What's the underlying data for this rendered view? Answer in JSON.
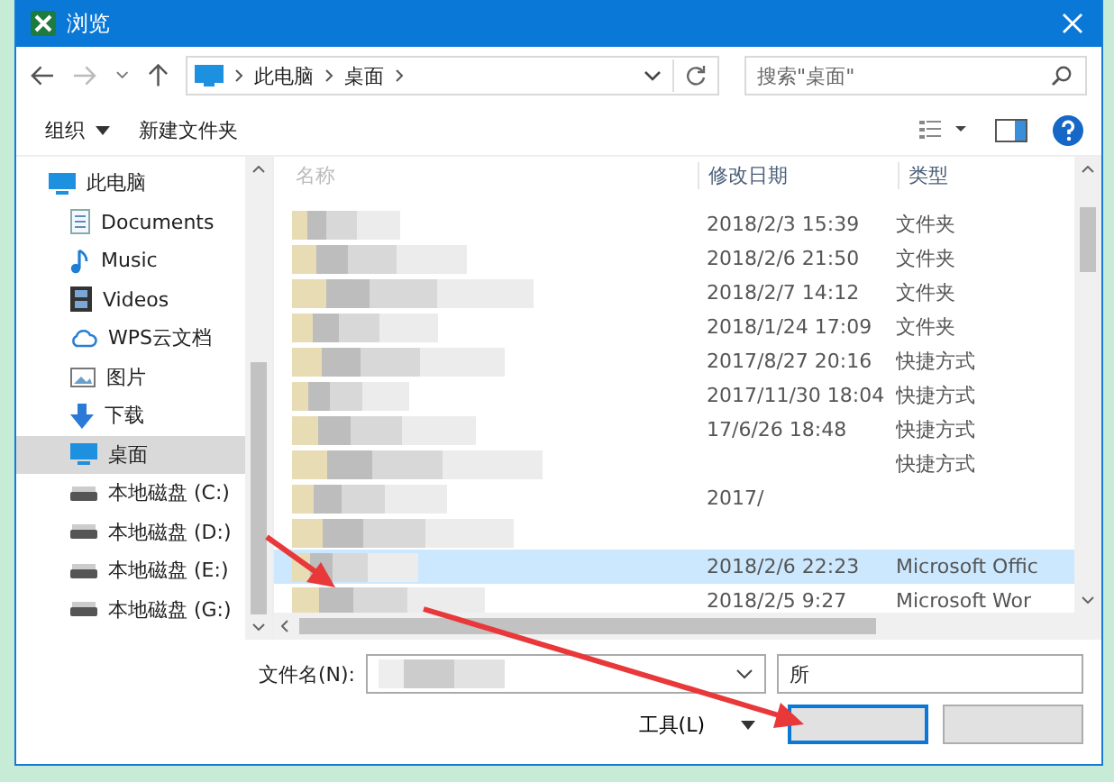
{
  "window": {
    "title": "浏览"
  },
  "address_bar": {
    "path": [
      "此电脑",
      "桌面"
    ]
  },
  "search": {
    "placeholder": "搜索\"桌面\""
  },
  "toolbar": {
    "organize": "组织",
    "new_folder": "新建文件夹"
  },
  "nav": [
    {
      "label": "此电脑",
      "kind": "computer",
      "selected": false,
      "children": [
        {
          "label": "Documents",
          "kind": "document",
          "selected": false
        },
        {
          "label": "Music",
          "kind": "music",
          "selected": false
        },
        {
          "label": "Videos",
          "kind": "video",
          "selected": false
        },
        {
          "label": "WPS云文档",
          "kind": "cloud",
          "selected": false
        },
        {
          "label": "图片",
          "kind": "picture",
          "selected": false
        },
        {
          "label": "下载",
          "kind": "download",
          "selected": false
        },
        {
          "label": "桌面",
          "kind": "desktop",
          "selected": true
        },
        {
          "label": "本地磁盘 (C:)",
          "kind": "drive",
          "selected": false
        },
        {
          "label": "本地磁盘 (D:)",
          "kind": "drive",
          "selected": false
        },
        {
          "label": "本地磁盘 (E:)",
          "kind": "drive",
          "selected": false
        },
        {
          "label": "本地磁盘 (G:)",
          "kind": "drive",
          "selected": false
        }
      ]
    }
  ],
  "table": {
    "columns": [
      "名称",
      "修改日期",
      "类型"
    ],
    "rows": [
      {
        "date": "2018/2/3 15:39",
        "type": "文件夹",
        "selected": false
      },
      {
        "date": "2018/2/6 21:50",
        "type": "文件夹",
        "selected": false
      },
      {
        "date": "2018/2/7 14:12",
        "type": "文件夹",
        "selected": false
      },
      {
        "date": "2018/1/24 17:09",
        "type": "文件夹",
        "selected": false
      },
      {
        "date": "2017/8/27 20:16",
        "type": "快捷方式",
        "selected": false
      },
      {
        "date": "2017/11/30 18:04",
        "type": "快捷方式",
        "selected": false
      },
      {
        "date": "17/6/26 18:48",
        "type": "快捷方式",
        "selected": false
      },
      {
        "type": "快捷方式",
        "selected": false
      },
      {
        "date": "2017/",
        "selected": false
      },
      {
        "selected": false
      },
      {
        "date": "2018/2/6 22:23",
        "type": "Microsoft Offic",
        "selected": true
      },
      {
        "date": "2018/2/5 9:27",
        "type": "Microsoft Wor",
        "selected": false
      }
    ]
  },
  "footer": {
    "filename_label": "文件名(N):",
    "filetype": "所",
    "tools": "工具(L)"
  }
}
